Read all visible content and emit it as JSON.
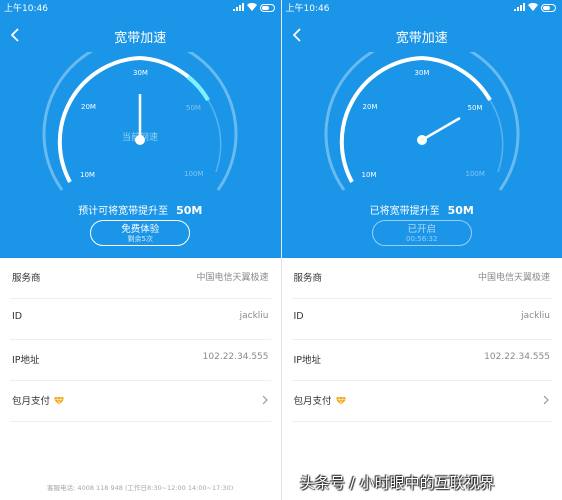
{
  "screens": [
    {
      "status_time": "上午10:46",
      "nav_title": "宽带加速",
      "gauge": {
        "current_label": "当前网速",
        "ticks": {
          "m10": "10M",
          "m20": "20M",
          "m30": "30M",
          "m50": "50M",
          "m100": "100M"
        },
        "needle_value_mbps": 30
      },
      "message": {
        "text": "预计可将宽带提升至",
        "value": "50M"
      },
      "cta": {
        "line1": "免费体验",
        "line2": "剩余5次"
      },
      "rows": [
        {
          "label": "服务商",
          "value": "中国电信天翼极速"
        },
        {
          "label": "ID",
          "value": "jackliu"
        },
        {
          "label": "IP地址",
          "value": "102.22.34.555"
        },
        {
          "label": "包月支付",
          "value": ""
        }
      ],
      "footer": "客服电话: 4008 118 948 (工作日8:30~12:00 14:00~17:30)"
    },
    {
      "status_time": "上午10:46",
      "nav_title": "宽带加速",
      "gauge": {
        "ticks": {
          "m10": "10M",
          "m20": "20M",
          "m30": "30M",
          "m50": "50M",
          "m100": "100M"
        },
        "needle_value_mbps": 50
      },
      "message": {
        "text": "已将宽带提升至",
        "value": "50M"
      },
      "cta": {
        "line1": "已开启",
        "line2": "00:56:32"
      },
      "rows": [
        {
          "label": "服务商",
          "value": "中国电信天翼极速"
        },
        {
          "label": "ID",
          "value": "jackliu"
        },
        {
          "label": "IP地址",
          "value": "102.22.34.555"
        },
        {
          "label": "包月支付",
          "value": ""
        }
      ]
    }
  ],
  "watermark": "头条号 / 小时眼中的互联视界",
  "colors": {
    "brand_blue": "#1a95e8",
    "gauge_glow": "#7cf2ff",
    "crown_gold": "#f0a81a"
  }
}
